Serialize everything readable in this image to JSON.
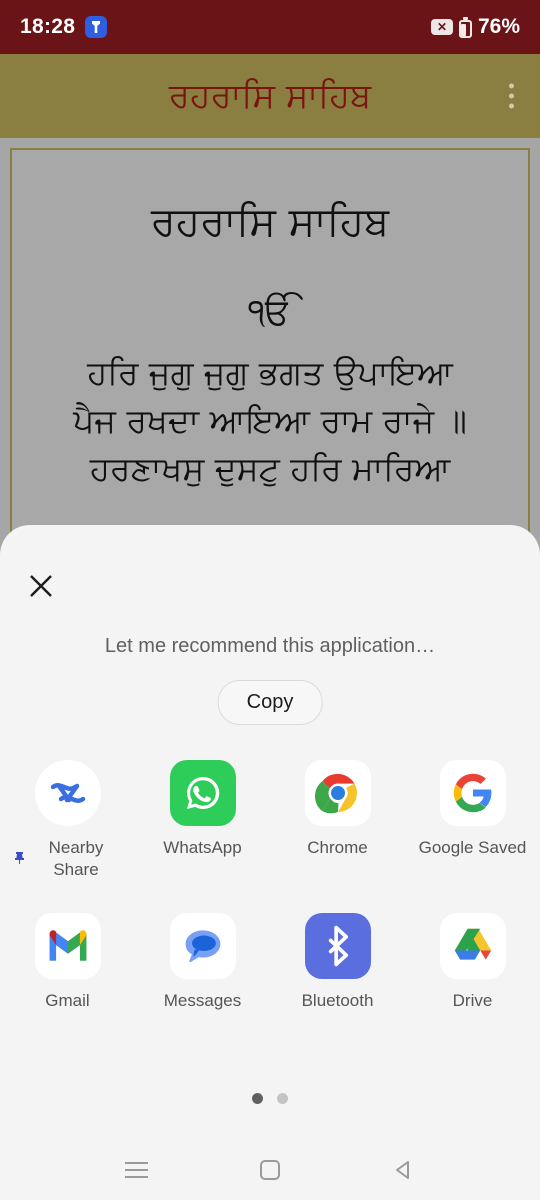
{
  "statusbar": {
    "time": "18:28",
    "app_notification_icon": "flashlight-icon",
    "no_sim_icon": "no-sim-icon",
    "no_sim_glyph": "✕",
    "battery_icon": "battery-icon",
    "battery_percent": "76%",
    "background_color": "#6b1418"
  },
  "appbar": {
    "title": "ਰਹਰਾਸਿ ਸਾਹਿਬ",
    "overflow_icon": "more-vertical-icon",
    "background_color": "#8a7f40",
    "title_color": "#7a1410"
  },
  "content": {
    "heading": "ਰਹਰਾਸਿ ਸਾਹਿਬ",
    "mool_mantar": "ੴ",
    "verses": [
      "ਹਰਿ ਜੁਗੁ ਜੁਗੁ ਭਗਤ ਉਪਾਇਆ",
      "ਪੈਜ ਰਖਦਾ ਆਇਆ ਰਾਮ ਰਾਜੇ ॥",
      "ਹਰਣਾਖਸੁ ਦੁਸਟੁ ਹਰਿ ਮਾਰਿਆ"
    ],
    "background_color": "#a8a8a8",
    "border_color": "#8a7f40"
  },
  "share_sheet": {
    "close_icon": "close-icon",
    "message": "Let me recommend this application…",
    "copy_label": "Copy",
    "apps": [
      {
        "name": "Nearby Share",
        "icon": "nearby-share-icon",
        "pinned": true,
        "pin_glyph": "📌"
      },
      {
        "name": "WhatsApp",
        "icon": "whatsapp-icon",
        "pinned": false
      },
      {
        "name": "Chrome",
        "icon": "chrome-icon",
        "pinned": false
      },
      {
        "name": "Google Saved",
        "icon": "google-icon",
        "pinned": false
      },
      {
        "name": "Gmail",
        "icon": "gmail-icon",
        "pinned": false
      },
      {
        "name": "Messages",
        "icon": "messages-icon",
        "pinned": false
      },
      {
        "name": "Bluetooth",
        "icon": "bluetooth-icon",
        "pinned": false
      },
      {
        "name": "Drive",
        "icon": "google-drive-icon",
        "pinned": false
      }
    ],
    "pages": {
      "count": 2,
      "active_index": 0
    },
    "background_color": "#f4f4f4"
  },
  "navbar": {
    "recents_icon": "recents-icon",
    "home_icon": "home-icon",
    "back_icon": "back-icon"
  }
}
